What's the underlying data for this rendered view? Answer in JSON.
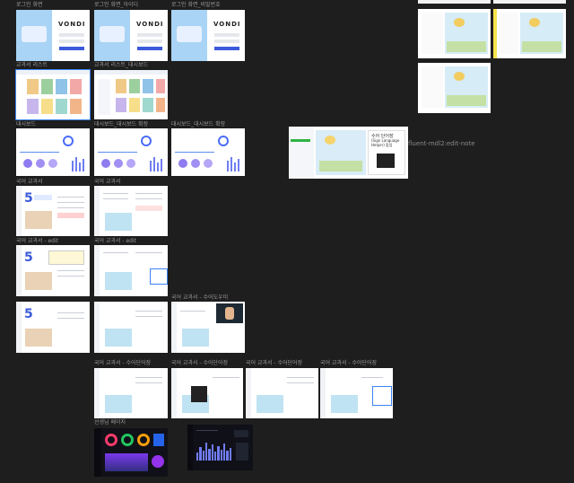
{
  "labels": {
    "login": "로그인 화면",
    "login_id": "로그인 화면_아이디",
    "login_pw": "로그인 화면_비밀번호",
    "textbook_list": "교과서 리스트",
    "textbook_list_dash": "교과서 리스트_대시보드",
    "dashboard": "대시보드",
    "dashboard_expand1": "대시보드_대시보드 확장",
    "dashboard_expand2": "대시보드_대시보드 확장",
    "korean1": "국어 교과서",
    "korean2": "국어 교과서",
    "korean_edit1": "국어 교과서 - edit",
    "korean_edit2": "국어 교과서 - edit",
    "korean_helper": "국어 교과서 - 수어도우미",
    "korean_sign1": "국어 교과서 - 수어단어장",
    "korean_sign2": "국어 교과서 - 수어단어장",
    "korean_sign3": "국어 교과서 - 수어단어장",
    "korean_sign4": "국어 교과서 - 수어단어장",
    "teacher_page": "선생님 페이지"
  },
  "login_logo": "VONDI",
  "popup": {
    "title": "수어 단어장",
    "line1": "(Sign Language",
    "line2": "Helper) 팝업"
  },
  "side_note": "fluent-mdl2:edit-note",
  "chapter_number": "5",
  "teacher_bar_heights": [
    0.4,
    0.7,
    0.5,
    0.9,
    0.6,
    0.8,
    0.45,
    0.75,
    0.55,
    0.85,
    0.5,
    0.65
  ]
}
